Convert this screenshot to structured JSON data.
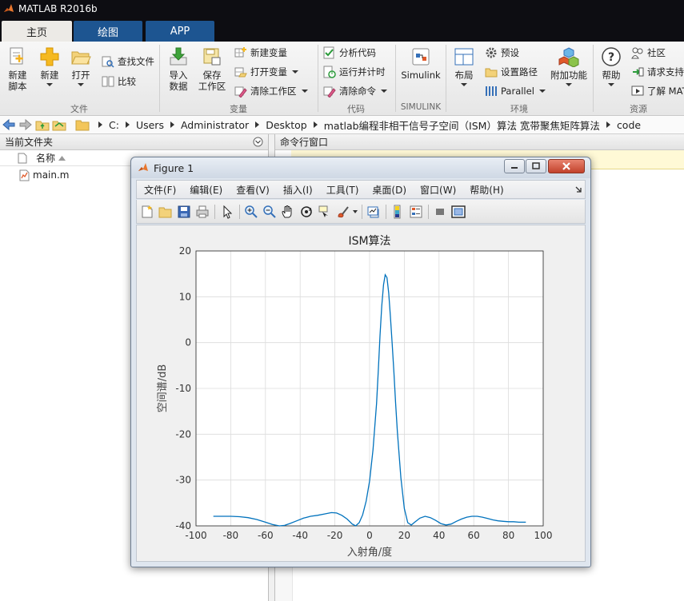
{
  "app": {
    "title": "MATLAB R2016b"
  },
  "tabs": [
    {
      "label": "主页",
      "active": true
    },
    {
      "label": "绘图",
      "active": false
    },
    {
      "label": "APP",
      "active": false
    }
  ],
  "ribbon": {
    "file": {
      "new_script": "新建\n脚本",
      "new": "新建",
      "open": "打开",
      "find_files": "查找文件",
      "compare": "比较",
      "group": "文件"
    },
    "variable": {
      "import": "导入\n数据",
      "save_ws": "保存\n工作区",
      "new_var": "新建变量",
      "open_var": "打开变量",
      "clear_ws": "清除工作区",
      "group": "变量"
    },
    "code": {
      "analyze": "分析代码",
      "run_time": "运行并计时",
      "clear_cmd": "清除命令",
      "group": "代码"
    },
    "simulink": {
      "label": "Simulink",
      "group": "SIMULINK"
    },
    "env": {
      "layout": "布局",
      "prefs": "预设",
      "set_path": "设置路径",
      "parallel": "Parallel",
      "addons": "附加功能",
      "group": "环境"
    },
    "resources": {
      "help": "帮助",
      "community": "社区",
      "support": "请求支持",
      "learn": "了解 MAT",
      "group": "资源"
    }
  },
  "address": {
    "crumbs": [
      "C:",
      "Users",
      "Administrator",
      "Desktop",
      "matlab编程非相干信号子空间（ISM）算法 宽带聚焦矩阵算法",
      "code"
    ]
  },
  "left_panel": {
    "title": "当前文件夹",
    "column": "名称",
    "files": [
      "main.m"
    ]
  },
  "right_panel": {
    "title": "命令行窗口"
  },
  "figure": {
    "title": "Figure 1",
    "menu": [
      "文件(F)",
      "编辑(E)",
      "查看(V)",
      "插入(I)",
      "工具(T)",
      "桌面(D)",
      "窗口(W)",
      "帮助(H)"
    ]
  },
  "chart_data": {
    "type": "line",
    "title": "ISM算法",
    "xlabel": "入射角/度",
    "ylabel": "空间谱/dB",
    "xlim": [
      -100,
      100
    ],
    "ylim": [
      -40,
      20
    ],
    "xticks": [
      -100,
      -80,
      -60,
      -40,
      -20,
      0,
      20,
      40,
      60,
      80,
      100
    ],
    "yticks": [
      20,
      10,
      0,
      -10,
      -20,
      -30,
      -40
    ],
    "grid": true,
    "line_color": "#0072bd",
    "x": [
      -90,
      -85,
      -80,
      -75,
      -70,
      -65,
      -60,
      -56,
      -52,
      -49,
      -46,
      -42,
      -38,
      -34,
      -30,
      -26,
      -22,
      -19,
      -16,
      -13,
      -10,
      -8,
      -6,
      -4,
      -2,
      0,
      2,
      4,
      5,
      6,
      7,
      8,
      9,
      10,
      11,
      12,
      13,
      14,
      15,
      16,
      18,
      20,
      22,
      24,
      26,
      29,
      32,
      35,
      38,
      41,
      44,
      47,
      50,
      53,
      56,
      59,
      62,
      65,
      68,
      71,
      74,
      77,
      80,
      83,
      86,
      90
    ],
    "y": [
      -37.9,
      -37.9,
      -37.9,
      -38.0,
      -38.2,
      -38.6,
      -39.2,
      -39.7,
      -40.0,
      -39.9,
      -39.5,
      -38.9,
      -38.3,
      -37.9,
      -37.7,
      -37.4,
      -37.1,
      -37.2,
      -37.7,
      -38.5,
      -39.6,
      -40.0,
      -39.3,
      -37.6,
      -34.6,
      -30.2,
      -23.3,
      -13.3,
      -6.0,
      1.5,
      8.0,
      12.6,
      14.8,
      14.2,
      10.8,
      5.7,
      -0.2,
      -6.5,
      -13.2,
      -19.4,
      -29.5,
      -36.2,
      -39.3,
      -39.8,
      -39.2,
      -38.3,
      -37.9,
      -38.2,
      -38.8,
      -39.5,
      -39.8,
      -39.6,
      -39.0,
      -38.5,
      -38.1,
      -37.9,
      -37.9,
      -38.1,
      -38.4,
      -38.7,
      -38.9,
      -39.0,
      -39.1,
      -39.1,
      -39.2,
      -39.2
    ]
  }
}
